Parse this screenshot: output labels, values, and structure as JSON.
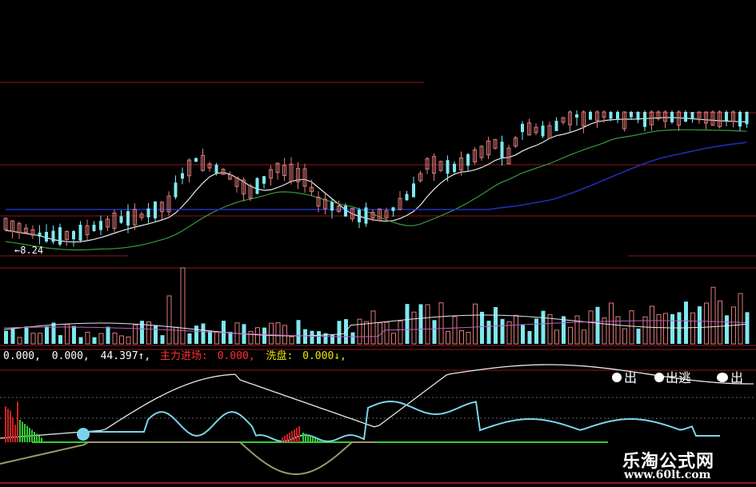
{
  "colors": {
    "background": "#000000",
    "up": "#e07a7a",
    "down": "#7ee8f0",
    "ma5": "#e8e8e8",
    "ma10": "#3a9a3a",
    "ma30": "#2030c0",
    "vol_ma": "#c060c0",
    "red_line": "#8b1a1a",
    "cyan_line": "#7ad4e8",
    "olive_line": "#9a9a6a",
    "green_bar": "#33cc33",
    "red_bar": "#cc2222",
    "text_white": "#ffffff",
    "text_red": "#ff3030",
    "text_yellow": "#e6e600",
    "text_cyan": "#40e0e0"
  },
  "price_low_label": "←8.24",
  "indicator_row": {
    "v1": "0.000,",
    "v2": "0.000,",
    "v3": "44.397↑,",
    "main_label": "主力进场:",
    "main_value": "0.000,",
    "wash_label": "洗盘:",
    "wash_value": "0.000↓,"
  },
  "signals": {
    "chu1": "出",
    "chutao": "出逃",
    "chu2": "出"
  },
  "watermark": {
    "title": "乐淘公式网",
    "url": "www.60lt.com"
  },
  "chart_data": {
    "type": "candlestick",
    "candles_count": 110,
    "price_low": 8.24,
    "panels": [
      "price",
      "volume",
      "indicator"
    ]
  }
}
